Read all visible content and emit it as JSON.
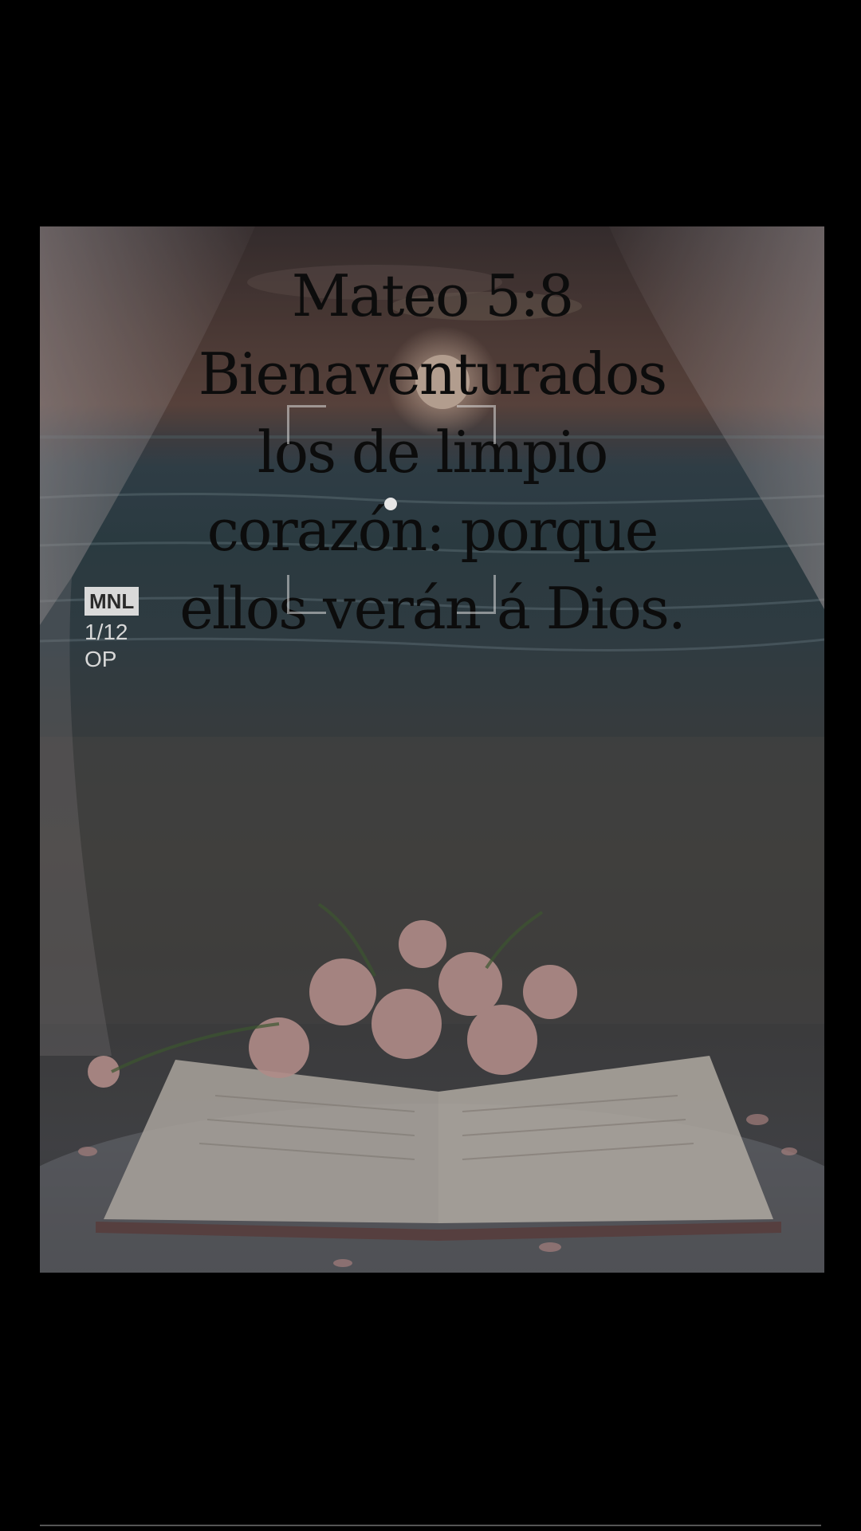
{
  "verse": {
    "lines": [
      "Mateo 5:8",
      "Bienaventurados",
      "los de limpio",
      "corazón: porque",
      "ellos verán á Dios."
    ]
  },
  "camera_overlay": {
    "mode_badge": "MNL",
    "shot_counter": "1/12",
    "op_label": "OP",
    "focus_icon": "focus-reticle-icon"
  },
  "colors": {
    "background": "#000000",
    "verse_text": "#0c0c0c",
    "overlay_text": "#d8d8d8"
  }
}
